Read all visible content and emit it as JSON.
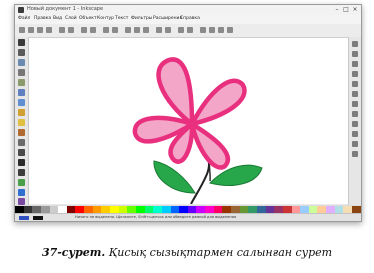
{
  "window": {
    "title": "Новый документ 1 - Inkscape",
    "controls": [
      "–",
      "□",
      "×"
    ]
  },
  "menu": [
    "Файл",
    "Правка",
    "Вид",
    "Слой",
    "Объект",
    "Контур",
    "Текст",
    "Фильтры",
    "Расширения",
    "Справка"
  ],
  "statusbar": {
    "text": "Ничего не выделено. Щелкните, Shift+щелчок или обведите рамкой для выделения"
  },
  "palette_colors": [
    "#000000",
    "#333333",
    "#666666",
    "#999999",
    "#cccccc",
    "#ffffff",
    "#800000",
    "#ff0000",
    "#ff6600",
    "#ff9900",
    "#ffcc00",
    "#ffff00",
    "#ccff00",
    "#66ff00",
    "#00ff00",
    "#00ff66",
    "#00ffcc",
    "#00ccff",
    "#0066ff",
    "#0000ff",
    "#6600ff",
    "#cc00ff",
    "#ff00cc",
    "#ff0066",
    "#993300",
    "#996633",
    "#669933",
    "#339966",
    "#336699",
    "#663399",
    "#993366",
    "#cc3333",
    "#ff9999",
    "#99ccff",
    "#ccff99",
    "#ffcc99",
    "#e0b0ff",
    "#b0e0e6",
    "#f5deb3",
    "#8b4513"
  ],
  "drawing": {
    "petal_fill": "#f4a6c8",
    "petal_stroke": "#e8307f",
    "leaf_fill": "#27a64a",
    "stem_color": "#222222"
  },
  "caption": {
    "number": "37-сурет.",
    "text": "Қисық сызықтармен салынған сурет"
  }
}
